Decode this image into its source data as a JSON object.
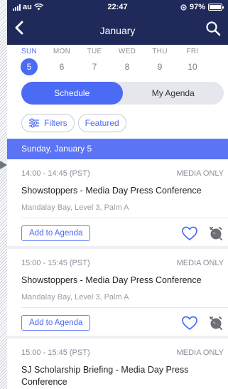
{
  "status": {
    "carrier": "au",
    "time": "22:47",
    "battery": "97%",
    "battery_level": 0.97
  },
  "header": {
    "title": "January"
  },
  "days": [
    {
      "name": "SUN",
      "num": "5",
      "active": true
    },
    {
      "name": "MON",
      "num": "6",
      "active": false
    },
    {
      "name": "TUE",
      "num": "7",
      "active": false
    },
    {
      "name": "WED",
      "num": "8",
      "active": false
    },
    {
      "name": "THU",
      "num": "9",
      "active": false
    },
    {
      "name": "FRI",
      "num": "10",
      "active": false
    }
  ],
  "tabs": {
    "schedule": "Schedule",
    "agenda": "My Agenda"
  },
  "filters": {
    "filters_label": "Filters",
    "featured_label": "Featured"
  },
  "date_header": "Sunday, January 5",
  "sessions": [
    {
      "time": "14:00 - 14:45 (PST)",
      "tag": "MEDIA ONLY",
      "title": "Showstoppers - Media Day Press Conference",
      "location": "Mandalay Bay, Level 3, Palm A",
      "add_label": "Add to Agenda"
    },
    {
      "time": "15:00 - 15:45 (PST)",
      "tag": "MEDIA ONLY",
      "title": "Showstoppers - Media Day Press Conference",
      "location": "Mandalay Bay, Level 3, Palm A",
      "add_label": "Add to Agenda"
    },
    {
      "time": "15:00 - 15:45 (PST)",
      "tag": "MEDIA ONLY",
      "title": "SJ Scholarship Briefing - Media Day Press Conference"
    }
  ],
  "colors": {
    "header_bg": "#1f2a5a",
    "accent": "#4b6bf5",
    "date_bar": "#5b74f5"
  }
}
